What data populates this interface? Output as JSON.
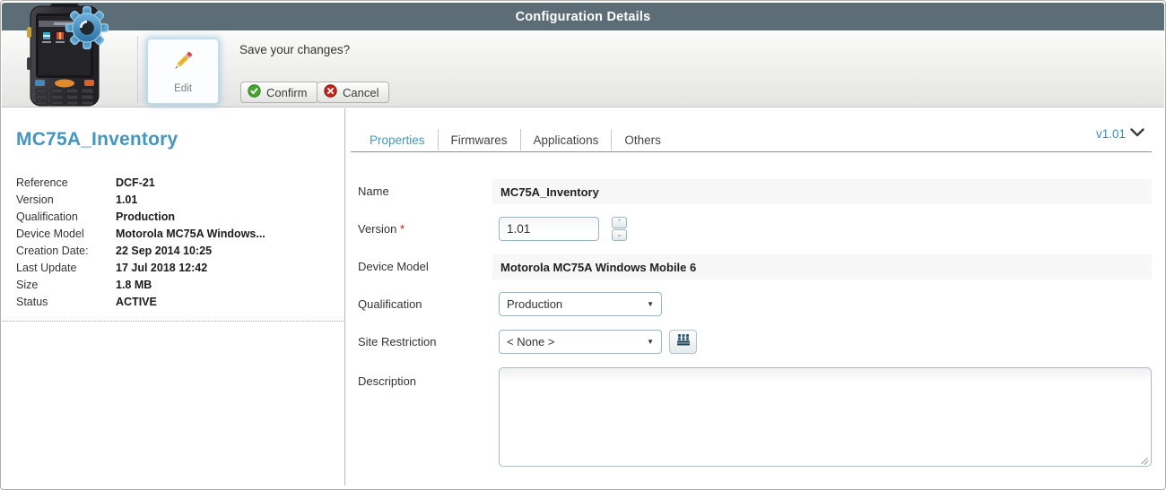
{
  "header": {
    "title": "Configuration Details"
  },
  "toolbar": {
    "edit_label": "Edit",
    "prompt": "Save your changes?",
    "confirm_label": "Confirm",
    "cancel_label": "Cancel"
  },
  "sidebar": {
    "title": "MC75A_Inventory",
    "details": [
      {
        "label": "Reference",
        "value": "DCF-21"
      },
      {
        "label": "Version",
        "value": "1.01"
      },
      {
        "label": "Qualification",
        "value": "Production"
      },
      {
        "label": "Device Model",
        "value": "Motorola MC75A Windows..."
      },
      {
        "label": "Creation Date:",
        "value": "22 Sep 2014 10:25"
      },
      {
        "label": "Last Update",
        "value": "17 Jul 2018 12:42"
      },
      {
        "label": "Size",
        "value": "1.8 MB"
      },
      {
        "label": "Status",
        "value": "ACTIVE"
      }
    ]
  },
  "content": {
    "tabs": [
      {
        "label": "Properties"
      },
      {
        "label": "Firmwares"
      },
      {
        "label": "Applications"
      },
      {
        "label": "Others"
      }
    ],
    "active_tab": "Properties",
    "version_selector": "v1.01",
    "form": {
      "name": {
        "label": "Name",
        "value": "MC75A_Inventory"
      },
      "version": {
        "label": "Version",
        "required_mark": "*",
        "value": "1.01"
      },
      "device_model": {
        "label": "Device Model",
        "value": "Motorola MC75A Windows Mobile 6"
      },
      "qualification": {
        "label": "Qualification",
        "value": "Production"
      },
      "site_restriction": {
        "label": "Site Restriction",
        "value": "< None >"
      },
      "description": {
        "label": "Description",
        "value": ""
      }
    }
  },
  "icons": {
    "gear": "gear-icon",
    "pencil": "pencil-icon",
    "confirm": "check-circle-icon",
    "cancel": "x-circle-icon",
    "sites": "sites-icon",
    "chevron": "chevron-down-icon"
  },
  "colors": {
    "accent_blue": "#4596be",
    "header_bg": "#5d6d77",
    "confirm_green": "#3ba12c",
    "cancel_red": "#c0251b",
    "required_red": "#cc1111"
  }
}
